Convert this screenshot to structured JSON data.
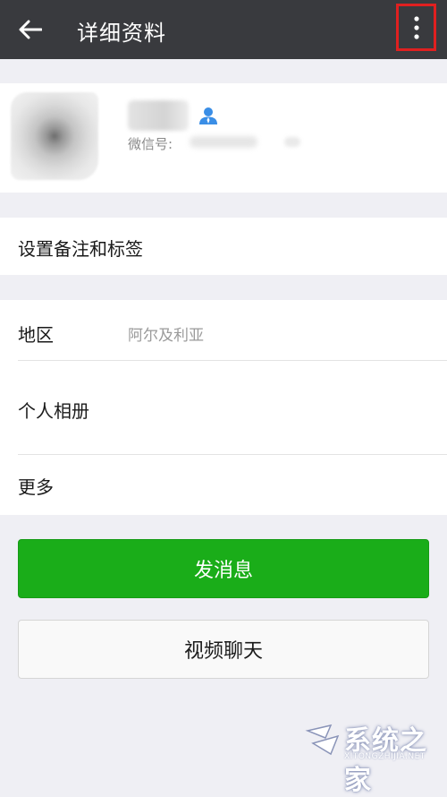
{
  "header": {
    "title": "详细资料",
    "back_icon": "back-arrow-icon",
    "more_icon": "more-vertical-icon",
    "highlight_color": "#e02020",
    "background_color": "#393a3e"
  },
  "profile": {
    "wechat_id_label": "微信号:",
    "user_icon": "user-contact-icon",
    "user_icon_color": "#3a8ee6"
  },
  "remark": {
    "label": "设置备注和标签"
  },
  "info": {
    "region_label": "地区",
    "region_value": "阿尔及利亚",
    "album_label": "个人相册",
    "more_label": "更多"
  },
  "actions": {
    "send_message": "发消息",
    "video_chat": "视频聊天",
    "send_color": "#1aad19"
  },
  "watermark": {
    "text": "系统之家",
    "sub": "XITONGZHIJIA.NET"
  }
}
